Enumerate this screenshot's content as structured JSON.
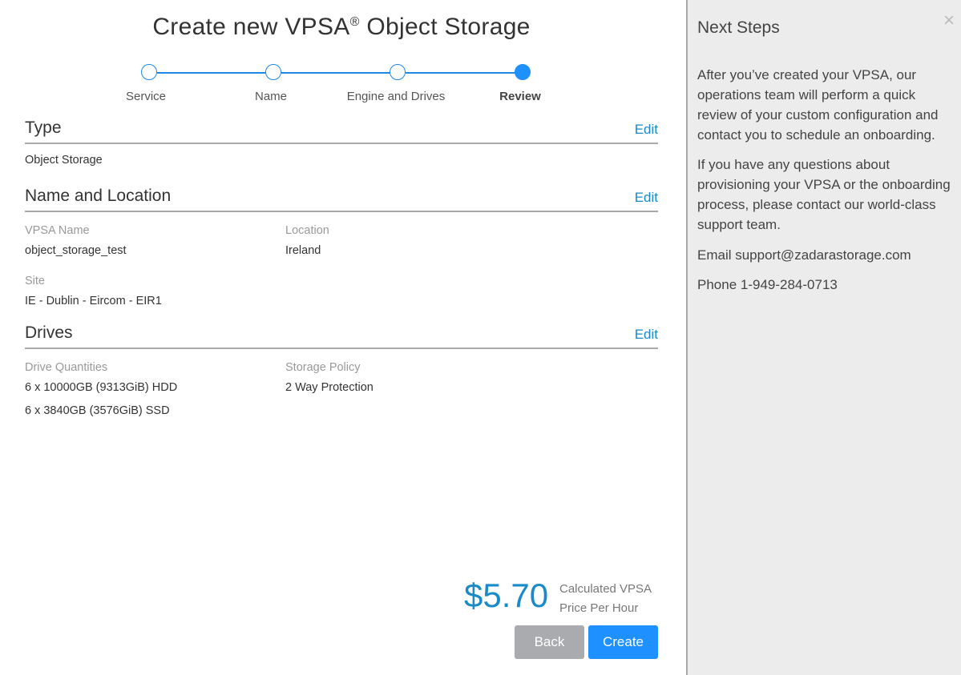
{
  "main": {
    "title": "Create new VPSA",
    "title_reg": "®",
    "title_suffix": " Object Storage"
  },
  "stepper": {
    "steps": [
      {
        "label": "Service"
      },
      {
        "label": "Name"
      },
      {
        "label": "Engine and Drives"
      },
      {
        "label": "Review"
      }
    ],
    "active_index": 3
  },
  "type_section": {
    "title": "Type",
    "edit": "Edit",
    "value": "Object Storage"
  },
  "name_section": {
    "title": "Name and Location",
    "edit": "Edit",
    "vpsa_name_label": "VPSA Name",
    "vpsa_name_value": "object_storage_test",
    "location_label": "Location",
    "location_value": "Ireland",
    "site_label": "Site",
    "site_value": "IE - Dublin - Eircom - EIR1"
  },
  "drives_section": {
    "title": "Drives",
    "edit": "Edit",
    "quantities_label": "Drive Quantities",
    "quantities": [
      "6 x 10000GB (9313GiB) HDD",
      "6 x 3840GB (3576GiB) SSD"
    ],
    "policy_label": "Storage Policy",
    "policy_value": "2 Way Protection"
  },
  "pricing": {
    "price": "$5.70",
    "note_line1": "Calculated VPSA",
    "note_line2": "Price Per Hour"
  },
  "buttons": {
    "back": "Back",
    "create": "Create"
  },
  "sidebar": {
    "title": "Next Steps",
    "close_icon": "close-icon",
    "para1": "After you’ve created your VPSA, our operations team will perform a quick review of your custom configuration and contact you to schedule an onboarding.",
    "para2": "If you have any questions about provisioning your VPSA or the onboarding process, please contact our world-class support team.",
    "email": "Email support@zadarastorage.com",
    "phone": "Phone 1-949-284-0713"
  },
  "colors": {
    "accent": "#1e90ff",
    "link": "#1a8ac9",
    "sidebar_bg": "#ececec",
    "back_button": "#a9abae"
  }
}
